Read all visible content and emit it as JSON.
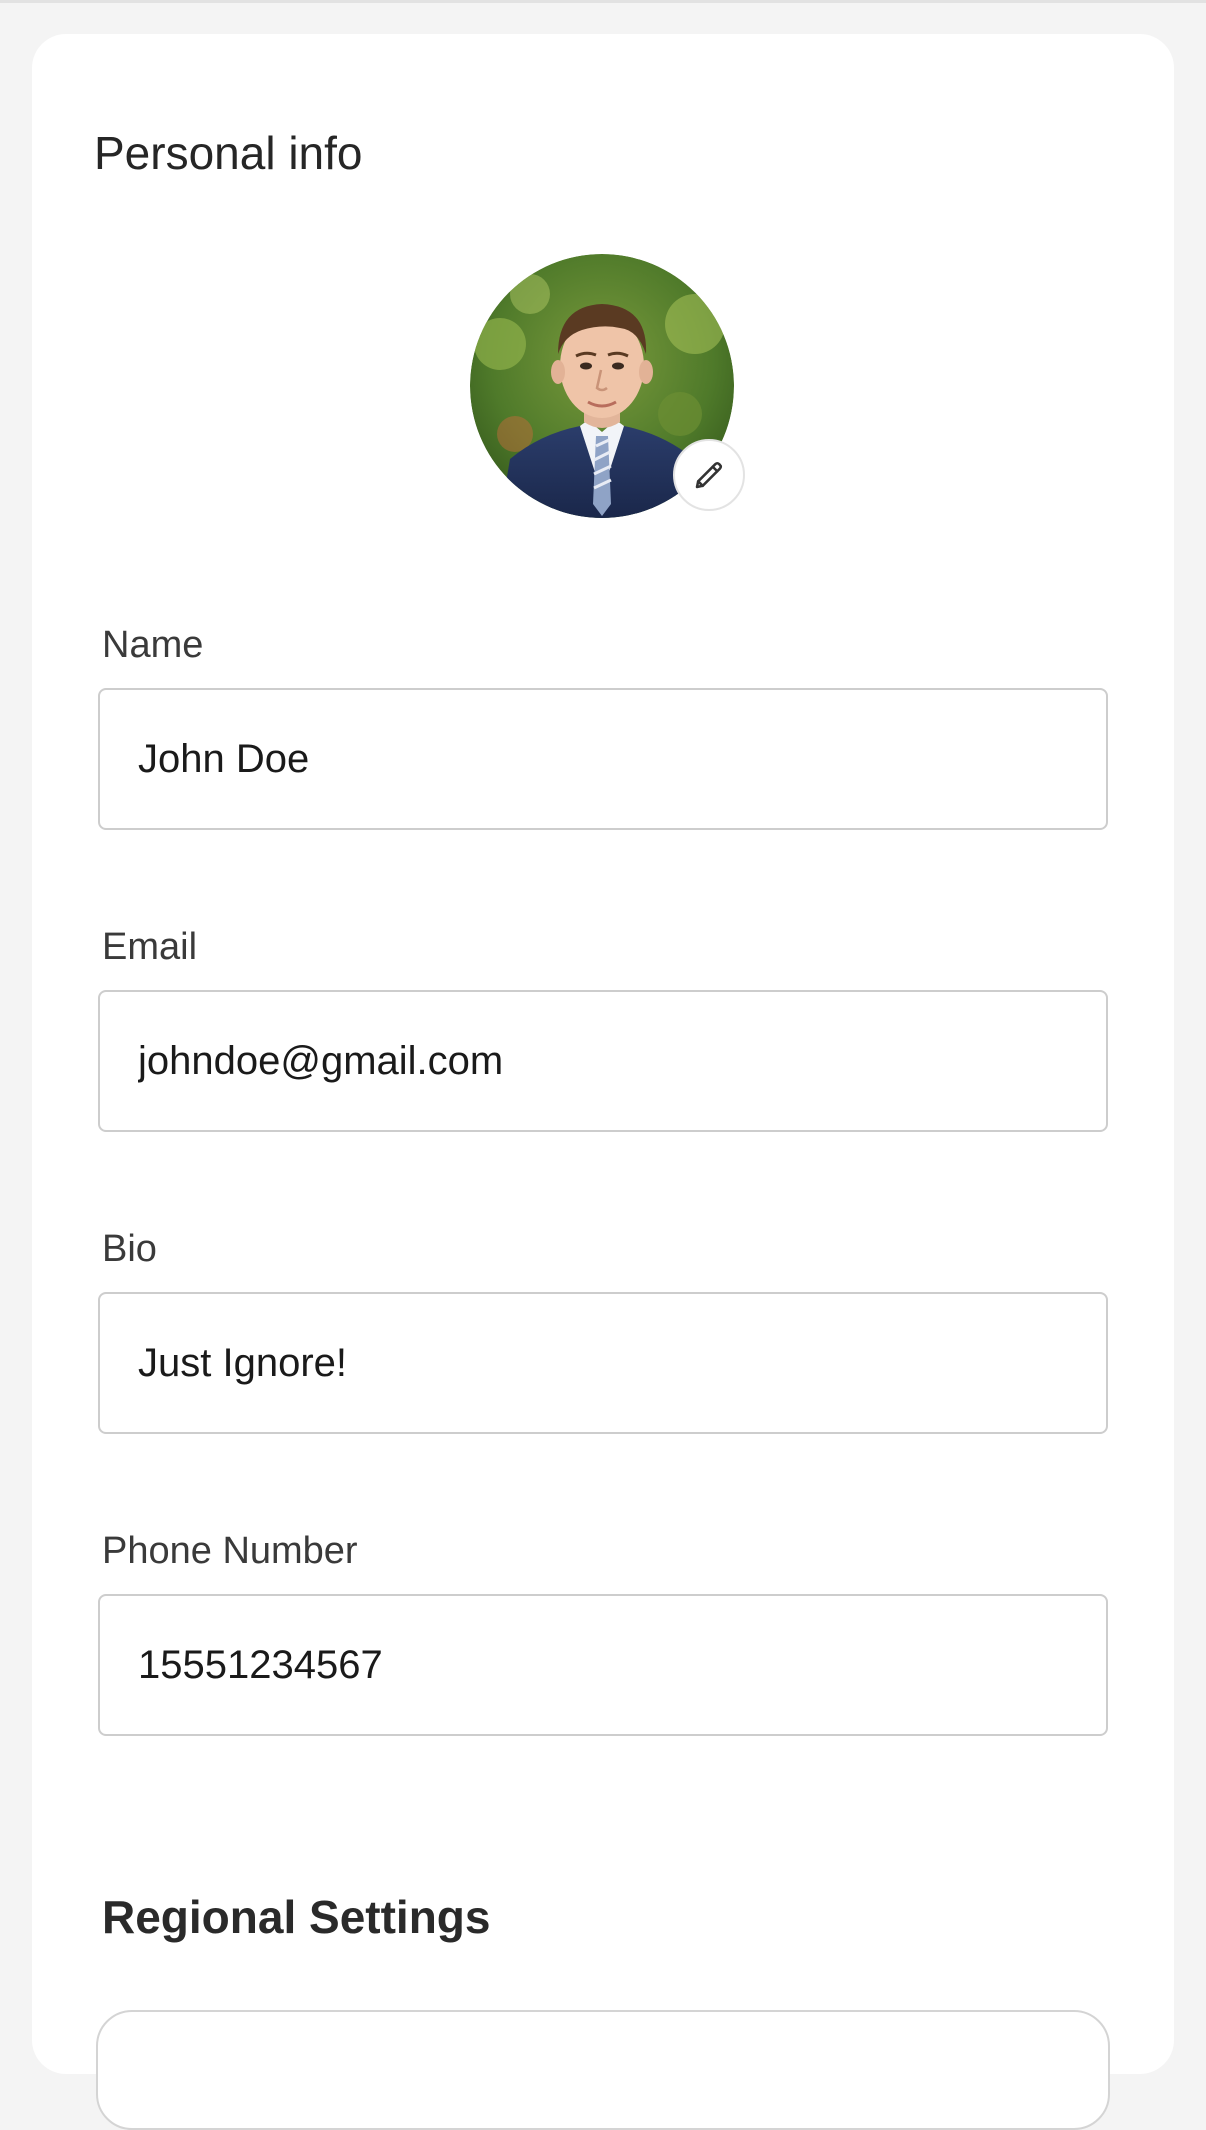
{
  "personal_info": {
    "title": "Personal info",
    "avatar": {
      "description_icon": "user-photo",
      "edit_icon": "pencil-icon"
    }
  },
  "fields": {
    "name": {
      "label": "Name",
      "value": "John Doe"
    },
    "email": {
      "label": "Email",
      "value": "johndoe@gmail.com"
    },
    "bio": {
      "label": "Bio",
      "value": "Just Ignore!"
    },
    "phone": {
      "label": "Phone Number",
      "value": "15551234567"
    }
  },
  "regional_settings": {
    "title": "Regional Settings"
  },
  "colors": {
    "background": "#f4f4f4",
    "card": "#ffffff",
    "input_border": "#cdcdcd",
    "text": "#1a1a1a"
  }
}
